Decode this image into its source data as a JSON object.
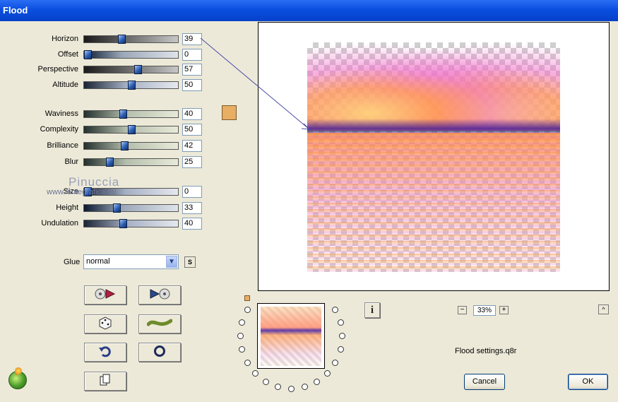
{
  "window": {
    "title": "Flood"
  },
  "sliders": [
    {
      "label": "Horizon",
      "value": "39",
      "level": 39
    },
    {
      "label": "Offset",
      "value": "0",
      "level": 0
    },
    {
      "label": "Perspective",
      "value": "57",
      "level": 57
    },
    {
      "label": "Altitude",
      "value": "50",
      "level": 50
    },
    {
      "label": "Waviness",
      "value": "40",
      "level": 40
    },
    {
      "label": "Complexity",
      "value": "50",
      "level": 50
    },
    {
      "label": "Brilliance",
      "value": "42",
      "level": 42
    },
    {
      "label": "Blur",
      "value": "25",
      "level": 25
    },
    {
      "label": "Size",
      "value": "0",
      "level": 0
    },
    {
      "label": "Height",
      "value": "33",
      "level": 33
    },
    {
      "label": "Undulation",
      "value": "40",
      "level": 40
    }
  ],
  "colors": {
    "flood_color": "#e8ae64"
  },
  "glue": {
    "label": "Glue",
    "selected": "normal"
  },
  "watermark": {
    "name": "Pinuccia",
    "site": "www.lentegrafica.eu"
  },
  "zoom": {
    "value": "33%"
  },
  "settings_file": "Flood settings.q8r",
  "buttons": {
    "cancel": "Cancel",
    "ok": "OK",
    "s": "S"
  },
  "icons": {
    "load": "load-preset-icon",
    "save": "save-preset-icon",
    "random": "dice-icon",
    "wave": "wave-icon",
    "undo": "undo-icon",
    "reset": "reset-circle-icon",
    "copy": "copy-icon",
    "info": "info-icon",
    "logo": "app-logo-icon"
  }
}
